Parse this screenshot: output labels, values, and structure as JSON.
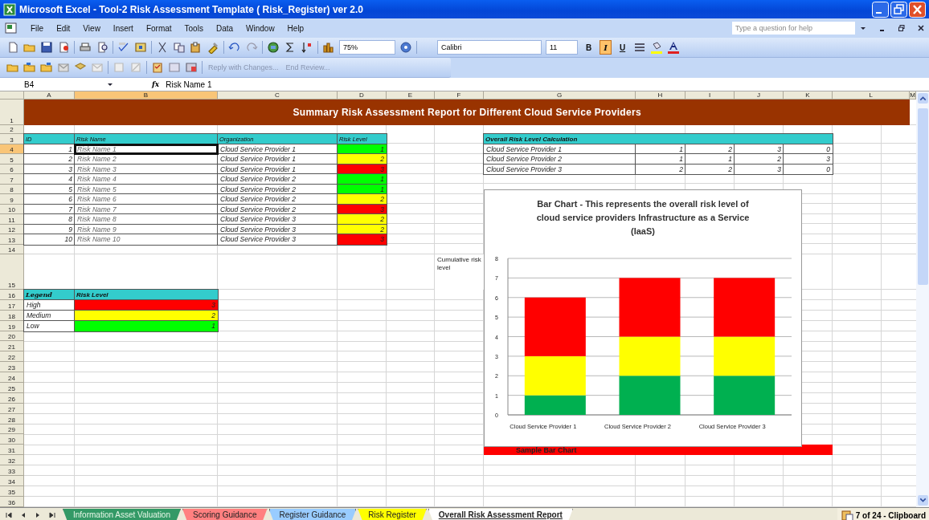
{
  "window": {
    "title": "Microsoft Excel - Tool-2 Risk Assessment Template ( Risk_Register) ver 2.0"
  },
  "menu": [
    "File",
    "Edit",
    "View",
    "Insert",
    "Format",
    "Tools",
    "Data",
    "Window",
    "Help"
  ],
  "help_box": {
    "placeholder": "Type a question for help"
  },
  "toolbar": {
    "zoom": "75%",
    "font": "Calibri",
    "size": "11"
  },
  "format_buttons": [
    {
      "label": "B",
      "kind": "bold",
      "on": false
    },
    {
      "label": "I",
      "kind": "italic",
      "on": true
    },
    {
      "label": "U",
      "kind": "underline",
      "on": false
    }
  ],
  "review_toolbar": [
    {
      "label": "Reply with Changes...",
      "disabled": true
    },
    {
      "label": "End Review...",
      "disabled": true
    }
  ],
  "formula_bar": {
    "name_box": "B4",
    "fx": "fx",
    "formula": "Risk Name 1"
  },
  "columns": [
    {
      "label": "A",
      "selected": false
    },
    {
      "label": "B",
      "selected": true
    },
    {
      "label": "C",
      "selected": false
    },
    {
      "label": "D",
      "selected": false
    },
    {
      "label": "E",
      "selected": false
    },
    {
      "label": "F",
      "selected": false
    },
    {
      "label": "G",
      "selected": false
    },
    {
      "label": "H",
      "selected": false
    },
    {
      "label": "I",
      "selected": false
    },
    {
      "label": "J",
      "selected": false
    },
    {
      "label": "K",
      "selected": false
    },
    {
      "label": "L",
      "selected": false
    },
    {
      "label": "M",
      "selected": false
    }
  ],
  "rows": [
    {
      "label": "1",
      "selected": false
    },
    {
      "label": "2",
      "selected": false
    },
    {
      "label": "3",
      "selected": false
    },
    {
      "label": "4",
      "selected": true
    },
    {
      "label": "5",
      "selected": false
    },
    {
      "label": "6",
      "selected": false
    },
    {
      "label": "7",
      "selected": false
    },
    {
      "label": "8",
      "selected": false
    },
    {
      "label": "9",
      "selected": false
    },
    {
      "label": "10",
      "selected": false
    },
    {
      "label": "11",
      "selected": false
    },
    {
      "label": "12",
      "selected": false
    },
    {
      "label": "13",
      "selected": false
    },
    {
      "label": "14",
      "selected": false
    },
    {
      "label": "15",
      "selected": false
    },
    {
      "label": "16",
      "selected": false
    },
    {
      "label": "17",
      "selected": false
    },
    {
      "label": "18",
      "selected": false
    },
    {
      "label": "19",
      "selected": false
    },
    {
      "label": "20",
      "selected": false
    },
    {
      "label": "21",
      "selected": false
    },
    {
      "label": "22",
      "selected": false
    },
    {
      "label": "23",
      "selected": false
    },
    {
      "label": "24",
      "selected": false
    },
    {
      "label": "25",
      "selected": false
    },
    {
      "label": "26",
      "selected": false
    },
    {
      "label": "27",
      "selected": false
    },
    {
      "label": "28",
      "selected": false
    },
    {
      "label": "29",
      "selected": false
    },
    {
      "label": "30",
      "selected": false
    },
    {
      "label": "31",
      "selected": false
    },
    {
      "label": "32",
      "selected": false
    },
    {
      "label": "33",
      "selected": false
    },
    {
      "label": "34",
      "selected": false
    },
    {
      "label": "35",
      "selected": false
    },
    {
      "label": "36",
      "selected": false
    }
  ],
  "report_title": "Summary Risk Assessment Report  for Different Cloud Service Providers",
  "risk_table": {
    "columns": [
      "ID",
      "Risk Name",
      "Organization",
      "Risk Level"
    ],
    "rows": [
      {
        "id": "1",
        "name": "Risk Name 1",
        "org": "Cloud Service Provider 1",
        "level": "1",
        "color": "#00ff00",
        "active": true
      },
      {
        "id": "2",
        "name": "Risk Name 2",
        "org": "Cloud Service Provider 1",
        "level": "2",
        "color": "#ffff00",
        "active": false
      },
      {
        "id": "3",
        "name": "Risk Name 3",
        "org": "Cloud Service Provider 1",
        "level": "3",
        "color": "#ff0000",
        "active": false
      },
      {
        "id": "4",
        "name": "Risk Name 4",
        "org": "Cloud Service Provider 2",
        "level": "1",
        "color": "#00ff00",
        "active": false
      },
      {
        "id": "5",
        "name": "Risk Name 5",
        "org": "Cloud Service Provider 2",
        "level": "1",
        "color": "#00ff00",
        "active": false
      },
      {
        "id": "6",
        "name": "Risk Name 6",
        "org": "Cloud Service Provider 2",
        "level": "2",
        "color": "#ffff00",
        "active": false
      },
      {
        "id": "7",
        "name": "Risk Name 7",
        "org": "Cloud Service Provider 2",
        "level": "3",
        "color": "#ff0000",
        "active": false
      },
      {
        "id": "8",
        "name": "Risk Name 8",
        "org": "Cloud Service Provider 3",
        "level": "2",
        "color": "#ffff00",
        "active": false
      },
      {
        "id": "9",
        "name": "Risk Name 9",
        "org": "Cloud Service Provider 3",
        "level": "2",
        "color": "#ffff00",
        "active": false
      },
      {
        "id": "10",
        "name": "Risk Name 10",
        "org": "Cloud Service Provider 3",
        "level": "3",
        "color": "#ff0000",
        "active": false
      }
    ]
  },
  "side_note": "Cumulative risk level",
  "legend": {
    "columns": [
      "Legend",
      "Risk Level"
    ],
    "rows": [
      {
        "label": "High",
        "value": "3",
        "color": "#ff0000"
      },
      {
        "label": "Medium",
        "value": "2",
        "color": "#ffff00"
      },
      {
        "label": "Low",
        "value": "1",
        "color": "#00ff00"
      }
    ]
  },
  "calc_table": {
    "title": "Overall Risk Level Calculation",
    "rows": [
      {
        "name": "Cloud Service Provider 1",
        "values": [
          "1",
          "2",
          "3",
          "0"
        ]
      },
      {
        "name": "Cloud Service Provider 2",
        "values": [
          "1",
          "1",
          "2",
          "3"
        ]
      },
      {
        "name": "Cloud Service Provider 3",
        "values": [
          "2",
          "2",
          "3",
          "0"
        ]
      }
    ]
  },
  "chart": {
    "chart_data": {
      "type": "bar",
      "title": "Bar Chart - This represents the overall risk level of cloud service providers Infrastructure as a Service (IaaS)",
      "categories": [
        "Cloud Service Provider 1",
        "Cloud Service Provider 2",
        "Cloud Service Provider 3"
      ],
      "stacked": true,
      "grid": true,
      "ylim": [
        0,
        8
      ],
      "yticks": [
        0,
        1,
        2,
        3,
        4,
        5,
        6,
        7,
        8
      ],
      "series": [
        {
          "color": "#00b050",
          "values": [
            1,
            2,
            2
          ]
        },
        {
          "color": "#ffff00",
          "values": [
            2,
            2,
            2
          ]
        },
        {
          "color": "#ff0000",
          "values": [
            3,
            3,
            3
          ]
        }
      ]
    }
  },
  "chart_caption": "Sample Bar Chart",
  "sheet_tabs": [
    {
      "label": "Information Asset Valuation",
      "color": "#339966",
      "selected": false
    },
    {
      "label": "Scoring Guidance",
      "color": "#ff8080",
      "selected": false
    },
    {
      "label": "Register Guidance",
      "color": "#99ccff",
      "selected": false
    },
    {
      "label": "Risk Register",
      "color": "#ffff00",
      "selected": false
    },
    {
      "label": "Overall Risk Assessment Report",
      "color": "#ffffff",
      "selected": true
    }
  ],
  "status": "7 of 24 - Clipboard"
}
